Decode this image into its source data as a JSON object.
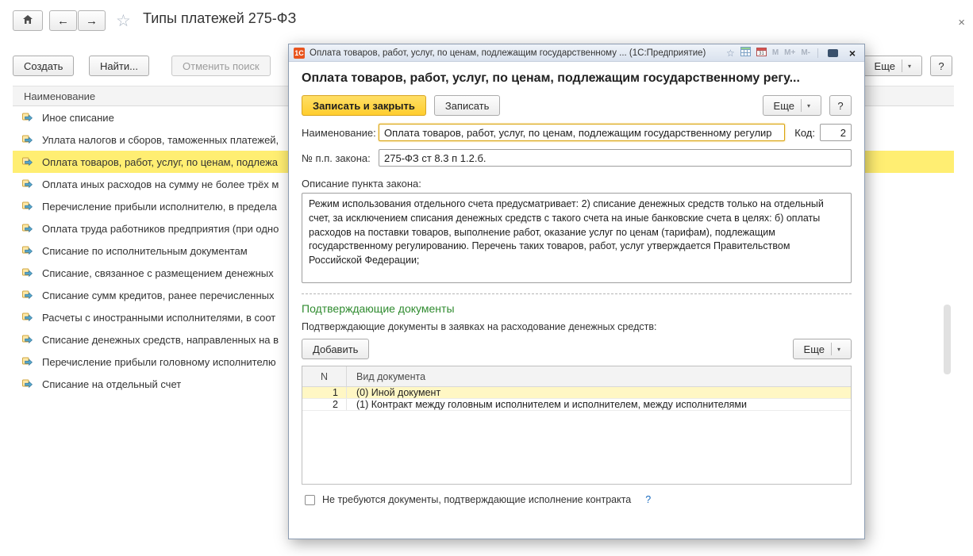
{
  "icons": {
    "back": "←",
    "forward": "→",
    "star": "☆",
    "close": "×",
    "dropdown": "▾"
  },
  "header": {
    "title": "Типы платежей 275-ФЗ"
  },
  "toolbar": {
    "create": "Создать",
    "find": "Найти...",
    "cancel_search": "Отменить поиск",
    "more": "Еще",
    "help": "?"
  },
  "list": {
    "header": "Наименование",
    "selected_index": 2,
    "items": [
      "Иное списание",
      "Уплата налогов и сборов, таможенных платежей,",
      "Оплата товаров, работ, услуг, по ценам, подлежа",
      "Оплата иных расходов на сумму не более трёх м",
      "Перечисление прибыли исполнителю, в предела",
      "Оплата труда работников предприятия (при одно",
      "Списание по исполнительным документам",
      "Списание, связанное с размещением денежных",
      "Списание сумм кредитов, ранее перечисленных",
      "Расчеты с иностранными исполнителями, в соот",
      "Списание денежных средств, направленных на в",
      "Перечисление прибыли головному исполнителю",
      "Списание на отдельный счет"
    ]
  },
  "dialog": {
    "titlebar": {
      "logo": "1С",
      "title": "Оплата товаров, работ, услуг, по ценам, подлежащим государственному ...  (1С:Предприятие)",
      "memory_buttons": [
        "M",
        "M+",
        "M-"
      ]
    },
    "heading": "Оплата товаров, работ, услуг, по ценам, подлежащим государственному регу...",
    "commands": {
      "save_close": "Записать и закрыть",
      "save": "Записать",
      "more": "Еще",
      "help": "?"
    },
    "fields": {
      "name_label": "Наименование:",
      "name_value": "Оплата товаров, работ, услуг, по ценам, подлежащим государственному регулир",
      "code_label": "Код:",
      "code_value": "2",
      "law_label": "№ п.п. закона:",
      "law_value": "275-ФЗ ст 8.3 п 1.2.б.",
      "desc_label": "Описание пункта закона:",
      "desc_value": "Режим использования отдельного счета предусматривает: 2) списание денежных средств только на отдельный счет, за исключением списания денежных средств с такого счета на иные банковские счета в целях: б) оплаты расходов на поставки товаров, выполнение работ, оказание услуг по ценам (тарифам), подлежащим государственному регулированию. Перечень таких товаров, работ, услуг утверждается Правительством Российской Федерации;"
    },
    "docs": {
      "section_title": "Подтверждающие документы",
      "section_hint": "Подтверждающие документы в заявках на расходование денежных средств:",
      "add": "Добавить",
      "more": "Еще",
      "col_n": "N",
      "col_doc": "Вид документа",
      "selected_index": 0,
      "rows": [
        {
          "n": "1",
          "doc": "(0) Иной документ"
        },
        {
          "n": "2",
          "doc": "(1) Контракт между головным исполнителем и исполнителем, между исполнителями"
        }
      ]
    },
    "checkbox_label": "Не требуются документы, подтверждающие исполнение контракта",
    "checkbox_help": "?"
  },
  "colors": {
    "accent_yellow": "#ffcd2e",
    "selected_row": "#ffee72",
    "selected_doc_row": "#fff7c4",
    "green_heading": "#2f8b2f",
    "link_blue": "#1a6bbf",
    "logo_orange": "#e8541e"
  }
}
